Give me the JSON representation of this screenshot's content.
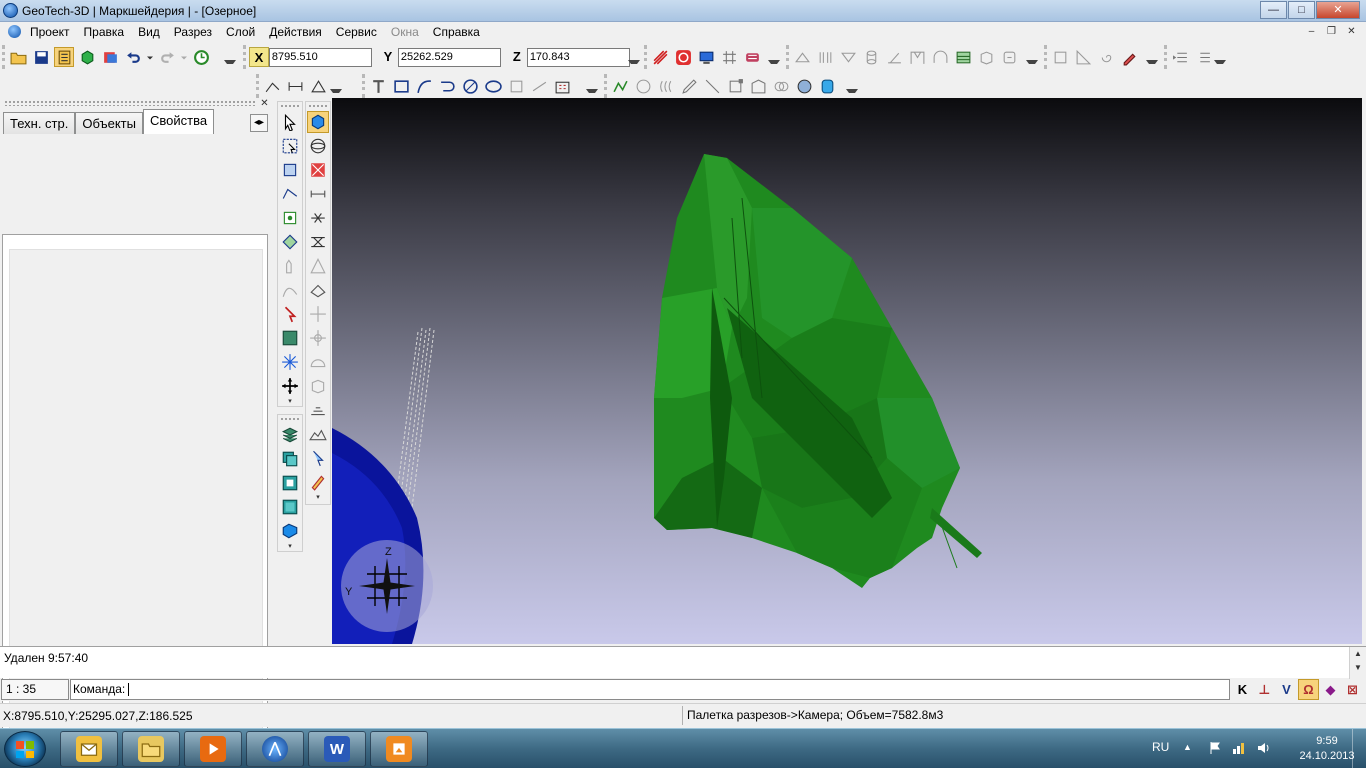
{
  "window": {
    "title": "GeoTech-3D | Маркшейдерия | - [Озерное]",
    "controls": {
      "minimize": "—",
      "maximize": "□",
      "close": "✕"
    }
  },
  "menu": {
    "items": [
      "Проект",
      "Правка",
      "Вид",
      "Разрез",
      "Слой",
      "Действия",
      "Сервис",
      "Окна",
      "Справка"
    ],
    "disabled": [
      "Окна"
    ],
    "mdi_controls": {
      "minimize": "–",
      "restore": "❐",
      "close": "✕"
    }
  },
  "coords": {
    "x_label": "X",
    "x_value": "8795.510",
    "y_label": "Y",
    "y_value": "25262.529",
    "z_label": "Z",
    "z_value": "170.843"
  },
  "left_panel": {
    "tabs": [
      "Техн. стр.",
      "Объекты",
      "Свойства"
    ],
    "active_tab": "Свойства",
    "close_glyph": "✕",
    "arrow_glyph": "◂▸"
  },
  "viewport": {
    "axis_z": "Z",
    "axis_y": "Y",
    "background_top": "#0b0b0e",
    "background_bottom": "#c9c9ea",
    "surface_color": "#1f8a1f",
    "tunnel_color": "#0a149c"
  },
  "output": {
    "message": "Удален 9:57:40"
  },
  "command": {
    "scale": "1 : 35",
    "prompt": "Команда:",
    "snaps": [
      "K",
      "⊥",
      "V",
      "Ω",
      "◆",
      "⊠"
    ]
  },
  "status": {
    "left": "X:8795.510,Y:25295.027,Z:186.525",
    "right": "Палетка разрезов->Камера; Объем=7582.8м3"
  },
  "taskbar": {
    "apps": [
      "outlook-icon",
      "explorer-icon",
      "media-player-icon",
      "geotech-icon",
      "word-icon",
      "presentation-icon"
    ],
    "word_glyph": "W",
    "lang": "RU",
    "time": "9:59",
    "date": "24.10.2013"
  }
}
